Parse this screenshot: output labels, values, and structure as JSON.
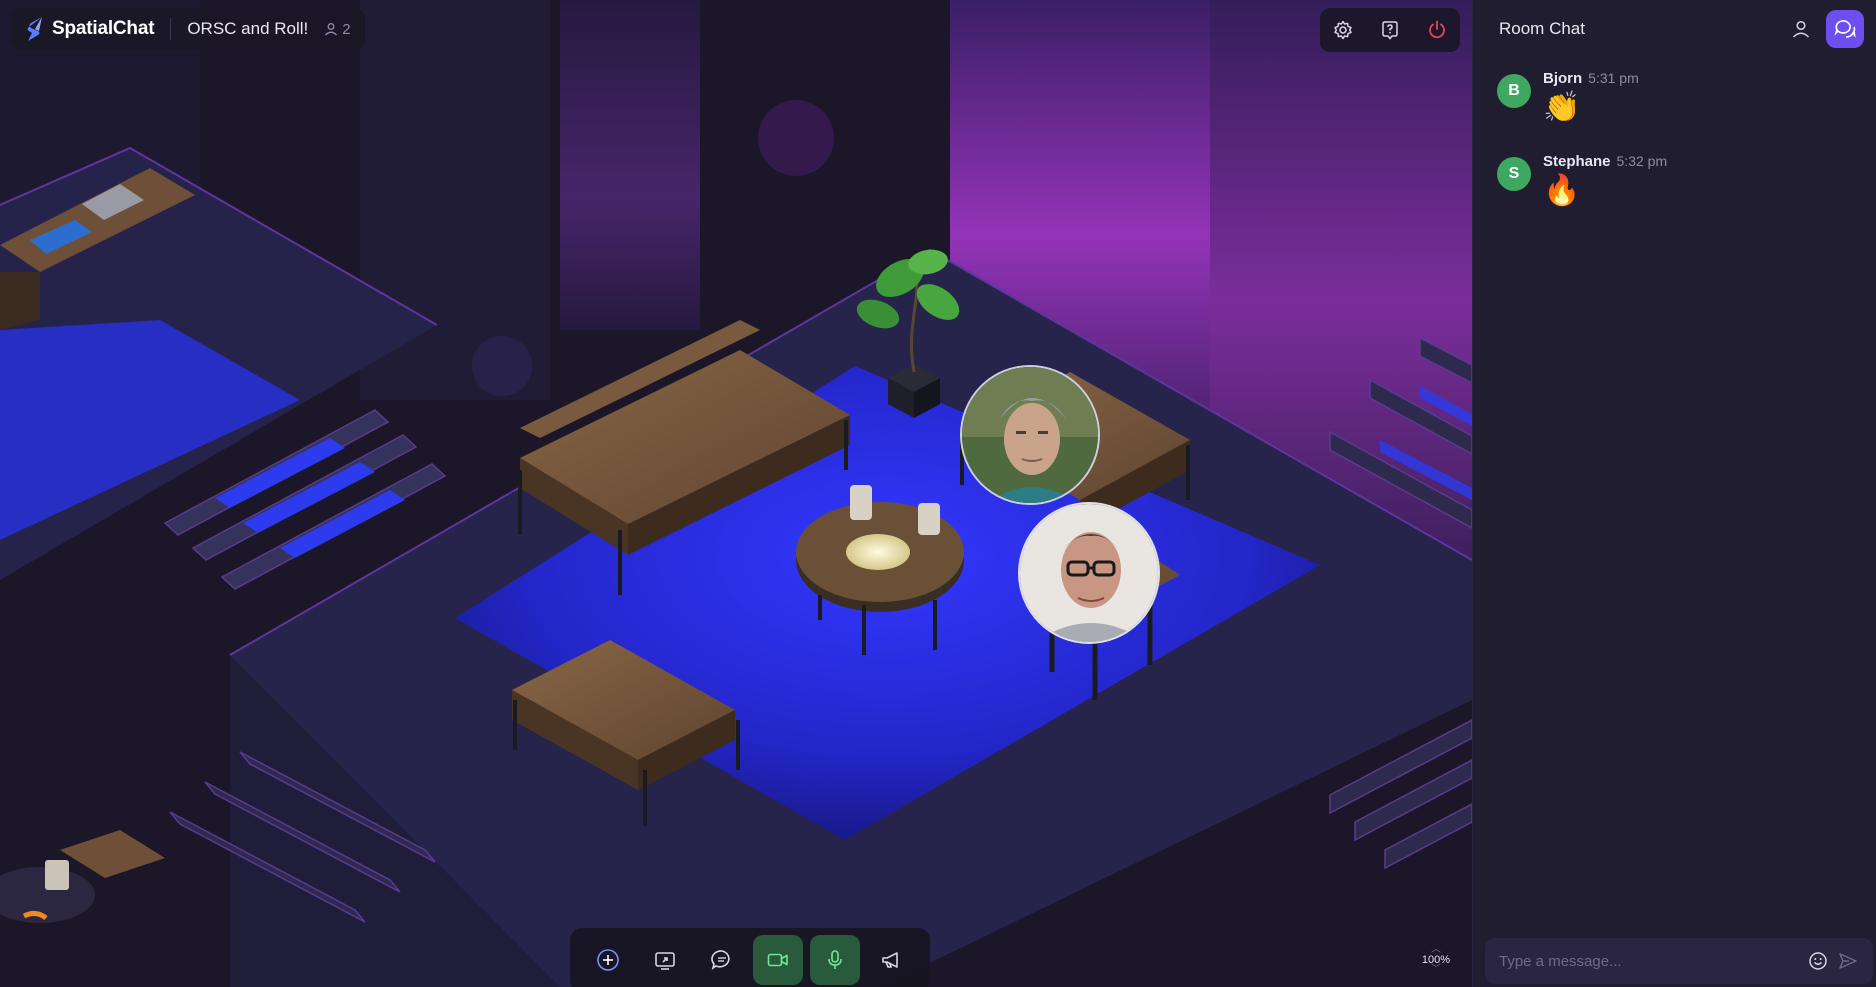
{
  "app": {
    "brand": "SpatialChat",
    "room_name": "ORSC and Roll!",
    "participant_count": "2"
  },
  "toolbar": {
    "zoom_level": "100%",
    "buttons": [
      {
        "name": "add-button",
        "icon": "plus-circle-icon"
      },
      {
        "name": "share-screen-button",
        "icon": "screen-share-icon"
      },
      {
        "name": "chat-bubble-button",
        "icon": "chat-bubble-icon"
      },
      {
        "name": "camera-button",
        "icon": "video-camera-icon",
        "active": true
      },
      {
        "name": "microphone-button",
        "icon": "microphone-icon",
        "active": true
      },
      {
        "name": "broadcast-button",
        "icon": "megaphone-icon"
      }
    ]
  },
  "chat": {
    "title": "Room Chat",
    "placeholder": "Type a message...",
    "messages": [
      {
        "initial": "B",
        "name": "Bjorn",
        "time": "5:31 pm",
        "body": "👏"
      },
      {
        "initial": "S",
        "name": "Stephane",
        "time": "5:32 pm",
        "body": "🔥"
      }
    ]
  },
  "colors": {
    "accent": "#6d4ff0",
    "avatar_green": "#3ea760",
    "active_green": "#2a5a3c",
    "power_red": "#e2455a",
    "floor_blue": "#2b2ee0"
  }
}
